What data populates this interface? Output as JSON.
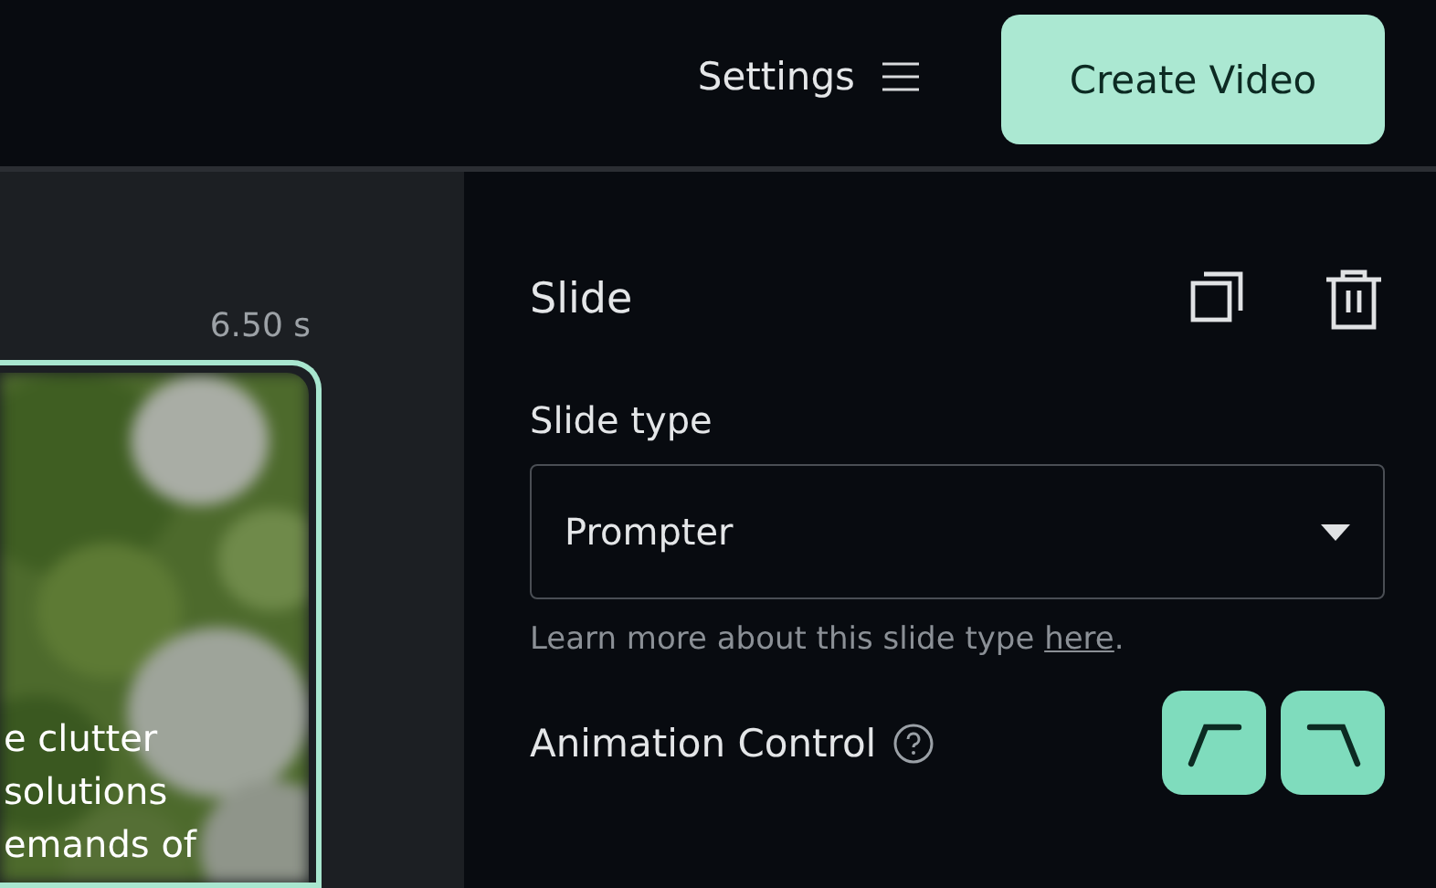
{
  "header": {
    "settings_label": "Settings",
    "create_button": "Create Video"
  },
  "timeline": {
    "duration": "6.50 s",
    "slide": {
      "selected": true,
      "lines": [
        "e clutter",
        "solutions",
        "emands of"
      ]
    }
  },
  "panel": {
    "title": "Slide",
    "slide_type_label": "Slide type",
    "slide_type_value": "Prompter",
    "help_text": "Learn more about this slide type ",
    "help_link": "here",
    "help_end": ".",
    "animation_label": "Animation Control",
    "animation_buttons": [
      {
        "kind": "ease-in",
        "selected": true
      },
      {
        "kind": "ease-out",
        "selected": true
      }
    ]
  }
}
